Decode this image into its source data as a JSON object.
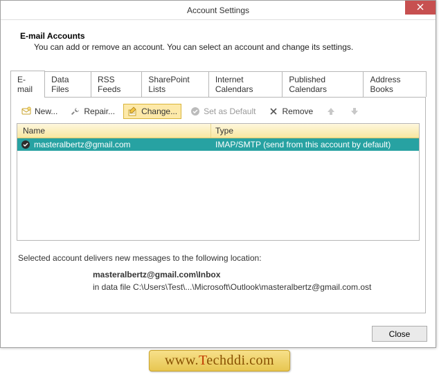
{
  "window": {
    "title": "Account Settings"
  },
  "header": {
    "title": "E-mail Accounts",
    "description": "You can add or remove an account. You can select an account and change its settings."
  },
  "tabs": [
    {
      "label": "E-mail",
      "active": true
    },
    {
      "label": "Data Files"
    },
    {
      "label": "RSS Feeds"
    },
    {
      "label": "SharePoint Lists"
    },
    {
      "label": "Internet Calendars"
    },
    {
      "label": "Published Calendars"
    },
    {
      "label": "Address Books"
    }
  ],
  "toolbar": {
    "new_label": "New...",
    "repair_label": "Repair...",
    "change_label": "Change...",
    "set_default_label": "Set as Default",
    "remove_label": "Remove"
  },
  "list": {
    "columns": {
      "name": "Name",
      "type": "Type"
    },
    "rows": [
      {
        "name": "masteralbertz@gmail.com",
        "type": "IMAP/SMTP (send from this account by default)",
        "selected": true
      }
    ]
  },
  "info": {
    "line1": "Selected account delivers new messages to the following location:",
    "account_location": "masteralbertz@gmail.com\\Inbox",
    "datafile_prefix": "in data file ",
    "datafile_path": "C:\\Users\\Test\\...\\Microsoft\\Outlook\\masteralbertz@gmail.com.ost"
  },
  "footer": {
    "close_label": "Close"
  },
  "watermark": {
    "prefix": "www.",
    "accent": "T",
    "rest": "echddi.com"
  }
}
